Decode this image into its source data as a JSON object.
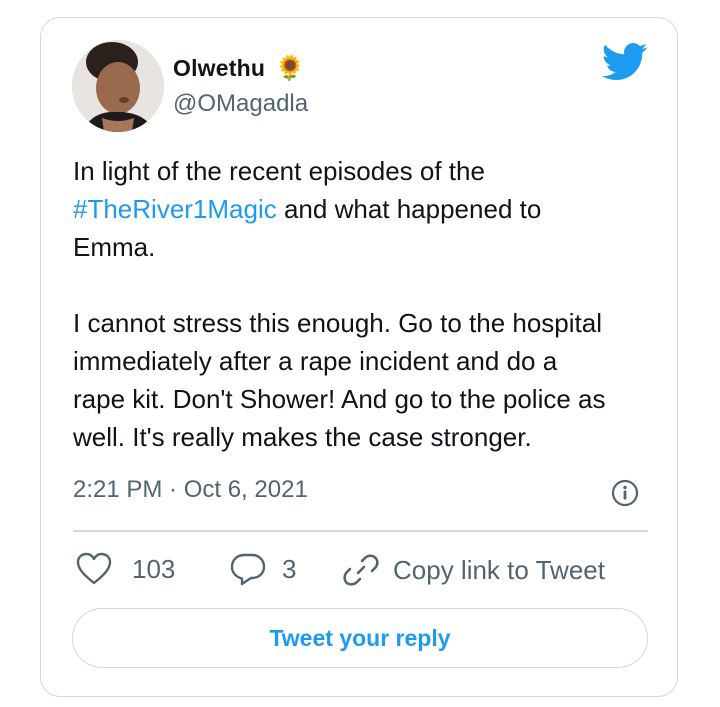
{
  "user": {
    "display_name": "Olwethu",
    "emoji": "🌻",
    "handle": "@OMagadla"
  },
  "tweet": {
    "line1_prefix": "In light of the recent episodes of the",
    "hashtag": "#TheRiver1Magic",
    "line2_suffix": " and what happened to",
    "line3": "Emma.",
    "para2": [
      "I cannot stress this enough. Go to the hospital",
      "immediately after a rape incident and do a",
      "rape kit. Don't Shower! And go to the police as",
      "well. It's really makes the case stronger."
    ],
    "timestamp": "2:21 PM · Oct 6, 2021"
  },
  "actions": {
    "likes": "103",
    "replies": "3",
    "copy_link": "Copy link to Tweet"
  },
  "reply_button": "Tweet your reply",
  "colors": {
    "accent": "#1d9bf0",
    "text": "#0f1419",
    "muted": "#536471",
    "border": "#cfd9de"
  },
  "icons": [
    "twitter-logo-icon",
    "info-icon",
    "heart-icon",
    "reply-bubble-icon",
    "link-icon"
  ]
}
